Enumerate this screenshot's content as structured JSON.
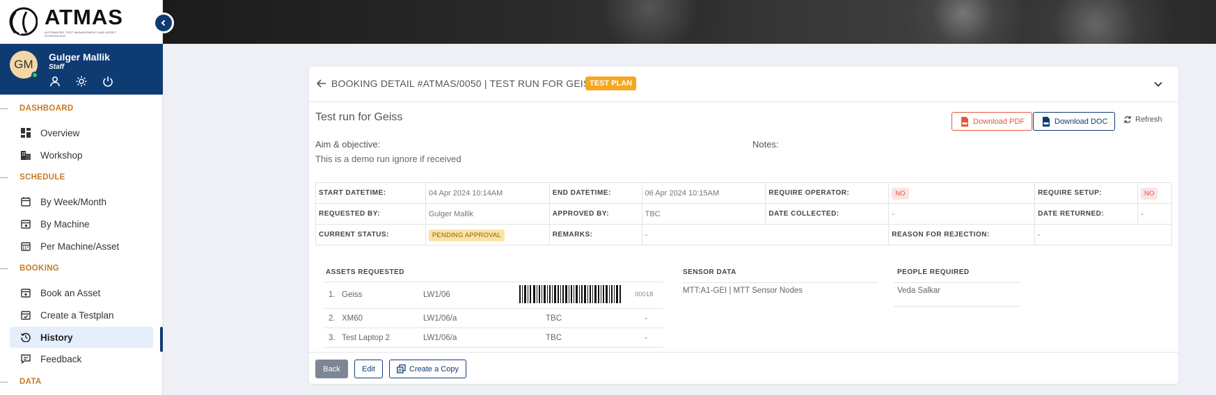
{
  "app": {
    "logo_text": "ATMAS",
    "logo_subtitle": "AUTOMATED TEST MANAGEMENT AND ASSET SCHEDULING"
  },
  "user": {
    "initials": "GM",
    "name": "Gulger Mallik",
    "role": "Staff"
  },
  "sidebar": {
    "sections": {
      "dashboard": "DASHBOARD",
      "schedule": "SCHEDULE",
      "booking": "BOOKING",
      "data": "DATA"
    },
    "items": {
      "overview": "Overview",
      "workshop": "Workshop",
      "by_week_month": "By Week/Month",
      "by_machine": "By Machine",
      "per_machine_asset": "Per Machine/Asset",
      "book_asset": "Book an Asset",
      "create_testplan": "Create a Testplan",
      "history": "History",
      "feedback": "Feedback"
    },
    "active_item": "History"
  },
  "booking": {
    "header_title": "BOOKING DETAIL #ATMAS/0050 | TEST RUN FOR GEISS",
    "type_badge": "TEST PLAN",
    "title": "Test run for Geiss",
    "aim_label": "Aim & objective:",
    "aim_text": "This is a demo run ignore if received",
    "notes_label": "Notes:",
    "download_pdf": "Download PDF",
    "download_doc": "Download DOC",
    "refresh": "Refresh",
    "fields": {
      "start_label": "START DATETIME:",
      "start_value": "04 Apr 2024 10:14AM",
      "end_label": "END DATETIME:",
      "end_value": "06 Apr 2024 10:15AM",
      "operator_label": "REQUIRE OPERATOR:",
      "operator_value": "NO",
      "setup_label": "REQUIRE SETUP:",
      "setup_value": "NO",
      "requested_label": "REQUESTED BY:",
      "requested_value": "Gulger Mallik",
      "approved_label": "APPROVED BY:",
      "approved_value": "TBC",
      "collected_label": "DATE COLLECTED:",
      "collected_value": "-",
      "returned_label": "DATE RETURNED:",
      "returned_value": "-",
      "status_label": "CURRENT STATUS:",
      "status_value": "PENDING APPROVAL",
      "remarks_label": "REMARKS:",
      "remarks_value": "-",
      "rejection_label": "REASON FOR REJECTION:",
      "rejection_value": "-"
    },
    "assets_heading": "ASSETS REQUESTED",
    "assets": [
      {
        "num": "1.",
        "name": "Geiss",
        "location": "LW1/06",
        "tag": "",
        "id": "00018"
      },
      {
        "num": "2.",
        "name": "XM60",
        "location": "LW1/06/a",
        "tag": "TBC",
        "id": "-"
      },
      {
        "num": "3.",
        "name": "Test Laptop 2",
        "location": "LW1/06/a",
        "tag": "TBC",
        "id": "-"
      }
    ],
    "sensor_heading": "SENSOR DATA",
    "sensor_value": "MTT:A1-GEI | MTT Sensor Nodes",
    "people_heading": "PEOPLE REQUIRED",
    "people_value": "Veda Salkar",
    "buttons": {
      "back": "Back",
      "edit": "Edit",
      "copy": "Create a Copy"
    }
  },
  "colors": {
    "brand": "#0f3b73",
    "accent": "#c97a25",
    "badge": "#f5a623",
    "danger": "#e8553b"
  }
}
